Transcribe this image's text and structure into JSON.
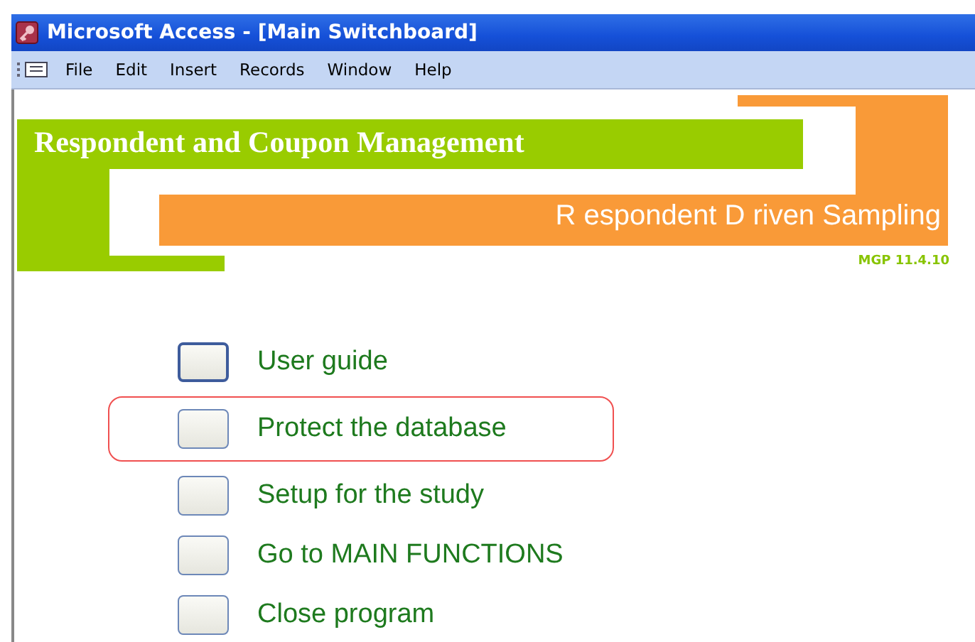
{
  "window": {
    "title": "Microsoft Access - [Main Switchboard]"
  },
  "menu": [
    "File",
    "Edit",
    "Insert",
    "Records",
    "Window",
    "Help"
  ],
  "banner": {
    "title": "Respondent and Coupon Management",
    "subtitle": "R espondent D riven Sampling",
    "version": "MGP 11.4.10"
  },
  "items": [
    {
      "label": "User guide",
      "focused": true,
      "highlighted": false
    },
    {
      "label": "Protect the database",
      "focused": false,
      "highlighted": true
    },
    {
      "label": "Setup for the study",
      "focused": false,
      "highlighted": false
    },
    {
      "label": "Go to MAIN FUNCTIONS",
      "focused": false,
      "highlighted": false
    },
    {
      "label": "Close program",
      "focused": false,
      "highlighted": false
    }
  ]
}
